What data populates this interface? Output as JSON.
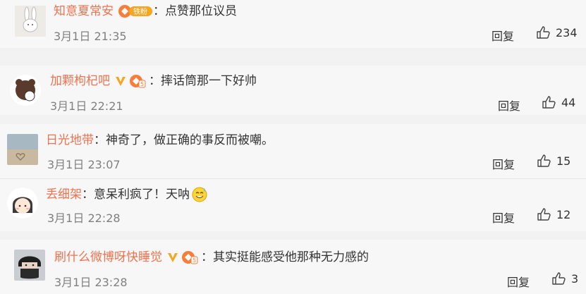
{
  "comments": [
    {
      "user": "知意夏常安",
      "badge": "铁粉",
      "badge_kind": "fan-badge",
      "text": "：点赞那位议员",
      "time": "3月1日 21:35",
      "reply": "回复",
      "likes": "234",
      "avatar": "rabbit-avatar"
    },
    {
      "user": "加颗枸杞吧",
      "badge_kind": "verified-v-and-level-5",
      "text": "：摔话筒那一下好帅",
      "time": "3月1日 22:21",
      "reply": "回复",
      "likes": "44",
      "avatar": "bear-avatar"
    },
    {
      "user": "日光地带",
      "text": "：神奇了，做正确的事反而被嘲。",
      "time": "3月1日 23:07",
      "reply": "回复",
      "likes": "15",
      "avatar": "beach-heart-avatar"
    },
    {
      "user": "丢细架",
      "text": "：意呆利疯了！天呐",
      "emoji": "sweat-smile-emoji",
      "time": "3月1日 22:28",
      "reply": "回复",
      "likes": "12",
      "avatar": "cartoon-girl-avatar"
    },
    {
      "user": "刷什么微博呀快睡觉",
      "badge_kind": "verified-v-and-level-5",
      "text": "：其实挺能感受他那种无力感的",
      "time": "3月1日 23:28",
      "reply": "回复",
      "likes": "3",
      "avatar": "masked-person-avatar"
    }
  ],
  "colors": {
    "username": "#eb7350",
    "text": "#333333",
    "time": "#808080",
    "card_bg": "#f7f7f7",
    "gap_bg": "#f2f2f2"
  }
}
